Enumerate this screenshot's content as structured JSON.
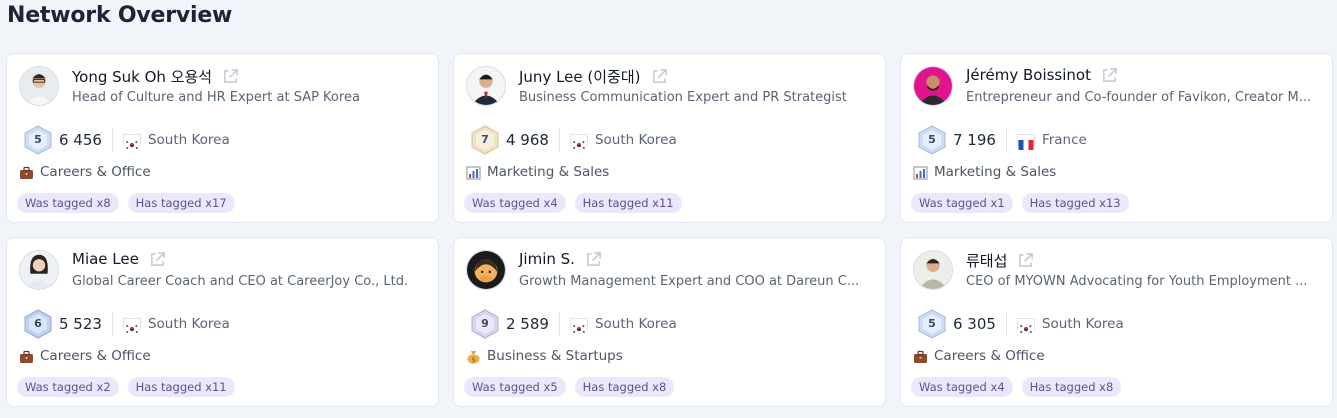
{
  "page": {
    "title": "Network Overview"
  },
  "cards": [
    {
      "name": "Yong Suk Oh 오용석",
      "headline": "Head of Culture and HR Expert at SAP Korea",
      "level": "5",
      "score": "6 456",
      "country": "South Korea",
      "flag_icon": "flag-kr-icon",
      "category": "Careers & Office",
      "category_icon": "briefcase-icon",
      "was_tagged": "Was tagged x8",
      "has_tagged": "Has tagged x17"
    },
    {
      "name": "Juny Lee (이중대)",
      "headline": "Business Communication Expert and PR Strategist",
      "level": "7",
      "score": "4 968",
      "country": "South Korea",
      "flag_icon": "flag-kr-icon",
      "category": "Marketing & Sales",
      "category_icon": "chart-icon",
      "was_tagged": "Was tagged x4",
      "has_tagged": "Has tagged x11"
    },
    {
      "name": "Jérémy Boissinot",
      "headline": "Entrepreneur and Co-founder of Favikon, Creator M...",
      "level": "5",
      "score": "7 196",
      "country": "France",
      "flag_icon": "flag-fr-icon",
      "category": "Marketing & Sales",
      "category_icon": "chart-icon",
      "was_tagged": "Was tagged x1",
      "has_tagged": "Has tagged x13"
    },
    {
      "name": "Miae Lee",
      "headline": "Global Career Coach and CEO at CareerJoy Co., Ltd.",
      "level": "6",
      "score": "5 523",
      "country": "South Korea",
      "flag_icon": "flag-kr-icon",
      "category": "Careers & Office",
      "category_icon": "briefcase-icon",
      "was_tagged": "Was tagged x2",
      "has_tagged": "Has tagged x11"
    },
    {
      "name": "Jimin S.",
      "headline": "Growth Management Expert and COO at Dareun C...",
      "level": "9",
      "score": "2 589",
      "country": "South Korea",
      "flag_icon": "flag-kr-icon",
      "category": "Business & Startups",
      "category_icon": "money-bag-icon",
      "was_tagged": "Was tagged x5",
      "has_tagged": "Has tagged x8"
    },
    {
      "name": "류태섭",
      "headline": "CEO of MYOWN Advocating for Youth Employment ...",
      "level": "5",
      "score": "6 305",
      "country": "South Korea",
      "flag_icon": "flag-kr-icon",
      "category": "Careers & Office",
      "category_icon": "briefcase-icon",
      "was_tagged": "Was tagged x4",
      "has_tagged": "Has tagged x8"
    }
  ],
  "colors": {
    "background": "#f1f4f9",
    "tag_bg": "#ebe8fb",
    "tag_text": "#5a5490",
    "level_badge": "#c9d6f2"
  }
}
